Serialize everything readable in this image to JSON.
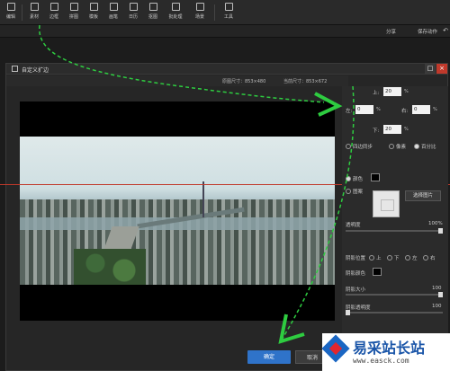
{
  "toolbar": {
    "items": [
      {
        "label": "编辑",
        "icon": "edit-icon"
      },
      {
        "label": "素材",
        "icon": "material-icon"
      },
      {
        "label": "边框",
        "icon": "border-icon"
      },
      {
        "label": "拼图",
        "icon": "collage-icon"
      },
      {
        "label": "模板",
        "icon": "template-icon"
      },
      {
        "label": "画笔",
        "icon": "brush-icon"
      },
      {
        "label": "日历",
        "icon": "calendar-icon"
      },
      {
        "label": "抠图",
        "icon": "cutout-icon"
      },
      {
        "label": "批处理",
        "icon": "batch-icon"
      },
      {
        "label": "场景",
        "icon": "scene-icon"
      },
      {
        "label": "工具",
        "icon": "tools-icon"
      }
    ],
    "share": "分享",
    "save_action": "保存动作"
  },
  "dialog": {
    "title": "自定义扩边",
    "original_size": "原图尺寸：853×480",
    "current_size": "当前尺寸：853×672"
  },
  "panel": {
    "top_label": "上:",
    "top_value": "20",
    "left_label": "左:",
    "left_value": "0",
    "right_label": "右:",
    "right_value": "0",
    "bottom_label": "下:",
    "bottom_value": "20",
    "unit": "%",
    "sync_label": "四边同步",
    "pixel_label": "像素",
    "percent_label": "百分比",
    "color_label": "颜色",
    "image_label": "图案",
    "pick_image": "选择图片",
    "opacity_label": "透明度",
    "opacity_max": "100%",
    "shadow_pos_label": "阴影位置",
    "shadow_up": "上",
    "shadow_down": "下",
    "shadow_left": "左",
    "shadow_right": "右",
    "shadow_color_label": "阴影颜色",
    "shadow_size_label": "阴影大小",
    "shadow_size_value": "100",
    "shadow_opacity_label": "阴影透明度",
    "shadow_opacity_value": "100"
  },
  "buttons": {
    "ok": "确定",
    "cancel": "取消"
  },
  "watermark": {
    "name": "易采站长站",
    "url": "www.easck.com"
  },
  "colors": {
    "accent": "#2f73c9",
    "arrow": "#2ecc40",
    "guide": "#c0392b"
  }
}
